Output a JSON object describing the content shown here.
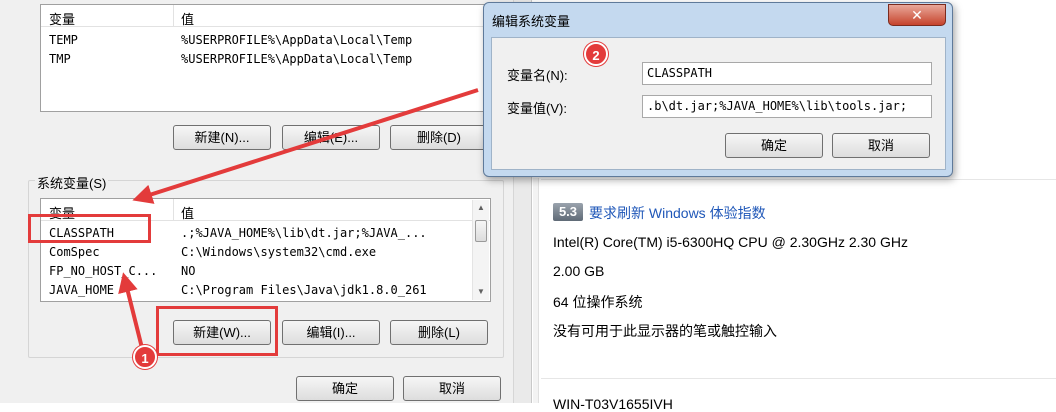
{
  "env_dialog": {
    "user_vars": {
      "col_name": "变量",
      "col_value": "值",
      "rows": [
        {
          "name": "TEMP",
          "value": "%USERPROFILE%\\AppData\\Local\\Temp"
        },
        {
          "name": "TMP",
          "value": "%USERPROFILE%\\AppData\\Local\\Temp"
        }
      ],
      "new_button": "新建(N)...",
      "edit_button": "编辑(E)...",
      "delete_button": "删除(D)"
    },
    "system_vars": {
      "group_label": "系统变量(S)",
      "col_name": "变量",
      "col_value": "值",
      "rows": [
        {
          "name": "CLASSPATH",
          "value": ".;%JAVA_HOME%\\lib\\dt.jar;%JAVA_..."
        },
        {
          "name": "ComSpec",
          "value": "C:\\Windows\\system32\\cmd.exe"
        },
        {
          "name": "FP_NO_HOST_C...",
          "value": "NO"
        },
        {
          "name": "JAVA_HOME",
          "value": "C:\\Program Files\\Java\\jdk1.8.0_261"
        }
      ],
      "new_button": "新建(W)...",
      "edit_button": "编辑(I)...",
      "delete_button": "删除(L)"
    },
    "ok_button": "确定",
    "cancel_button": "取消"
  },
  "edit_dialog": {
    "title": "编辑系统变量",
    "close_glyph": "✕",
    "name_label": "变量名(N):",
    "name_value": "CLASSPATH",
    "value_label": "变量值(V):",
    "value_value": ".b\\dt.jar;%JAVA_HOME%\\lib\\tools.jar;",
    "ok_button": "确定",
    "cancel_button": "取消"
  },
  "system_info": {
    "wei_score": "5.3",
    "wei_link": "要求刷新 Windows 体验指数",
    "processor": "Intel(R) Core(TM) i5-6300HQ CPU @ 2.30GHz   2.30 GHz",
    "memory": "2.00 GB",
    "system_type": "64 位操作系统",
    "pen_touch": "没有可用于此显示器的笔或触控输入",
    "bottom_text": "WIN-T03V1655IVH"
  },
  "annotations": {
    "badge_1": "1",
    "badge_2": "2"
  },
  "colors": {
    "annotation_red": "#e33b3b",
    "dialog_frame": "#c4d9ef",
    "link_blue": "#1f57b8"
  }
}
